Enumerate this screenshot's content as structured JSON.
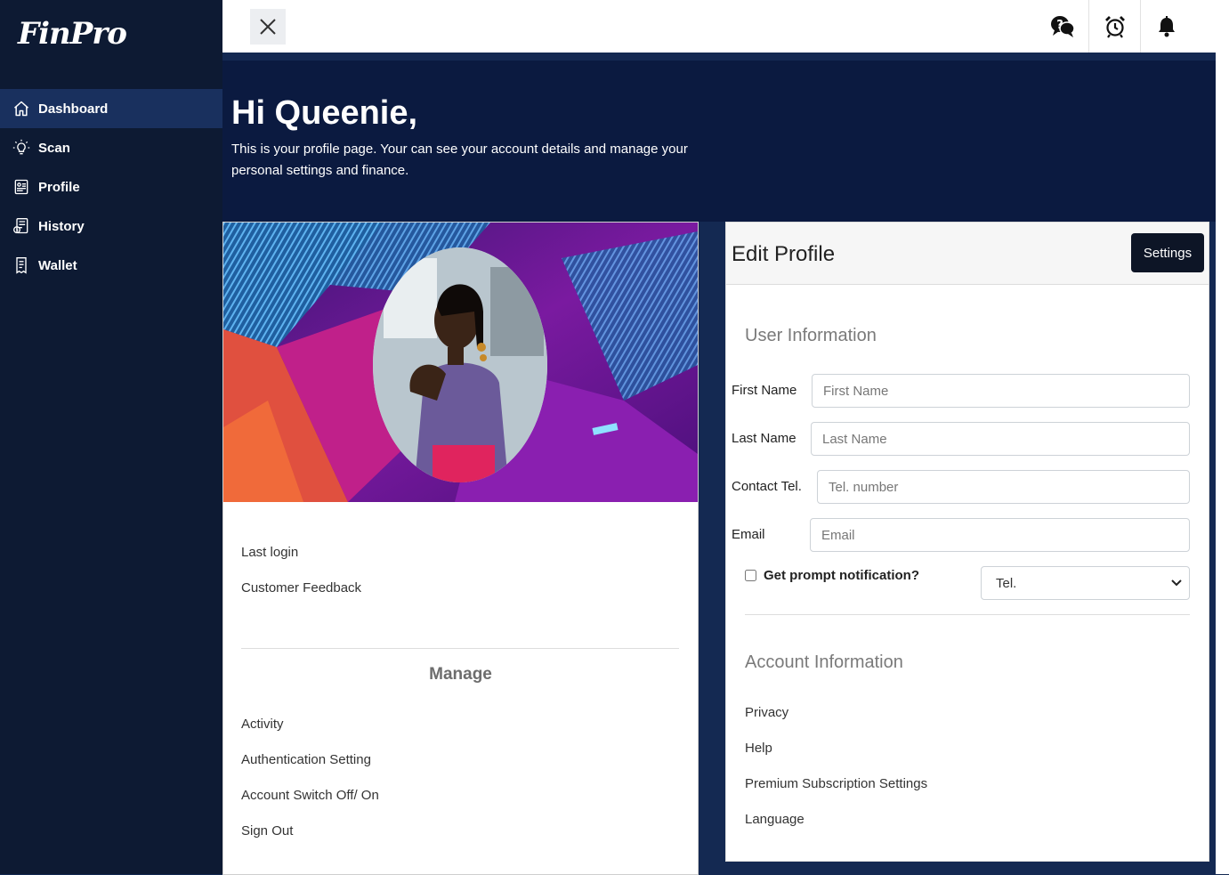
{
  "brand": {
    "logo": "FinPro"
  },
  "sidebar": {
    "items": [
      {
        "label": "Dashboard",
        "icon": "home-icon",
        "active": true
      },
      {
        "label": "Scan",
        "icon": "lightbulb-icon",
        "active": false
      },
      {
        "label": "Profile",
        "icon": "profile-card-icon",
        "active": false
      },
      {
        "label": "History",
        "icon": "history-icon",
        "active": false
      },
      {
        "label": "Wallet",
        "icon": "wallet-icon",
        "active": false
      }
    ]
  },
  "topbar": {
    "icons": [
      "close-icon",
      "chat-help-icon",
      "alarm-clock-icon",
      "bell-icon"
    ]
  },
  "hero": {
    "greeting": "Hi Queenie,",
    "description": "This is your profile page. Your can see your account details and manage your personal settings and finance."
  },
  "profile_card": {
    "links": [
      "Last login",
      "Customer Feedback"
    ],
    "manage_title": "Manage",
    "manage_links": [
      "Activity",
      "Authentication Setting",
      "Account Switch Off/ On",
      "Sign Out"
    ]
  },
  "edit_profile": {
    "title": "Edit Profile",
    "settings_label": "Settings",
    "user_info_title": "User Information",
    "fields": {
      "first_name": {
        "label": "First Name",
        "placeholder": "First Name",
        "value": ""
      },
      "last_name": {
        "label": "Last Name",
        "placeholder": "Last Name",
        "value": ""
      },
      "contact": {
        "label": "Contact Tel.",
        "placeholder": "Tel. number",
        "value": ""
      },
      "email": {
        "label": "Email",
        "placeholder": "Email",
        "value": ""
      }
    },
    "prompt_label": "Get prompt notification?",
    "prompt_checked": false,
    "prompt_select_value": "Tel.",
    "account_info_title": "Account Information",
    "account_links": [
      "Privacy",
      "Help",
      "Premium Subscription Settings",
      "Language"
    ]
  },
  "colors": {
    "sidebar_bg": "#0d1a33",
    "active_item_bg": "#19305e",
    "hero_bg": "#0b1a40",
    "page_bg": "#142952",
    "settings_button_bg": "#0d1526"
  }
}
